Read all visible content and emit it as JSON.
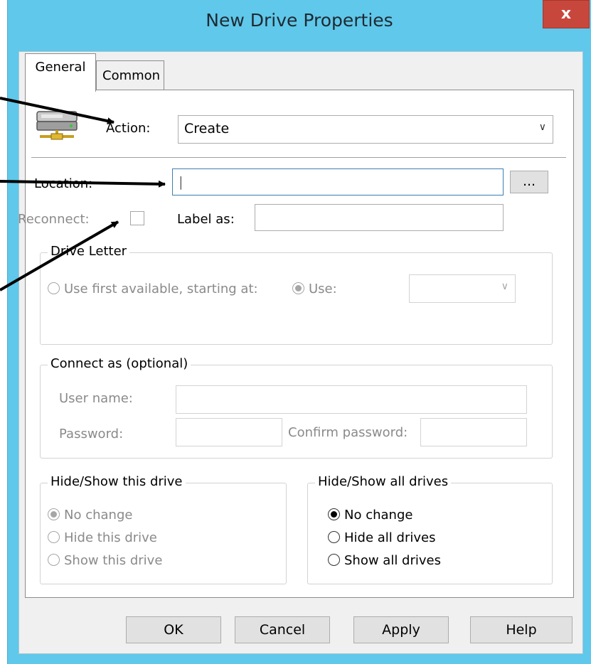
{
  "window": {
    "title": "New Drive Properties",
    "close_label": "x"
  },
  "tabs": [
    {
      "label": "General"
    },
    {
      "label": "Common"
    }
  ],
  "general": {
    "action_label": "Action:",
    "action_value": "Create",
    "location_label": "Location:",
    "location_value": "|",
    "browse_label": "...",
    "reconnect_label": "Reconnect:",
    "reconnect_checked": false,
    "label_as_label": "Label as:",
    "label_as_value": ""
  },
  "drive_letter": {
    "legend": "Drive Letter",
    "use_first_label": "Use first available, starting at:",
    "use_label": "Use:",
    "selected": "Use",
    "letter_value": ""
  },
  "connect_as": {
    "legend": "Connect as (optional)",
    "user_name_label": "User name:",
    "password_label": "Password:",
    "confirm_password_label": "Confirm password:",
    "user_name_value": "",
    "password_value": "",
    "confirm_value": ""
  },
  "hide_show_this": {
    "legend": "Hide/Show this drive",
    "options": [
      "No change",
      "Hide this drive",
      "Show this drive"
    ],
    "selected": "No change"
  },
  "hide_show_all": {
    "legend": "Hide/Show all drives",
    "options": [
      "No change",
      "Hide all drives",
      "Show all drives"
    ],
    "selected": "No change"
  },
  "buttons": {
    "ok": "OK",
    "cancel": "Cancel",
    "apply": "Apply",
    "help": "Help"
  },
  "icons": {
    "drive_icon": "network-drive-icon",
    "dropdown_icon": "chevron-down-icon"
  },
  "colors": {
    "titlebar": "#60c8ea",
    "close": "#c8473c"
  }
}
